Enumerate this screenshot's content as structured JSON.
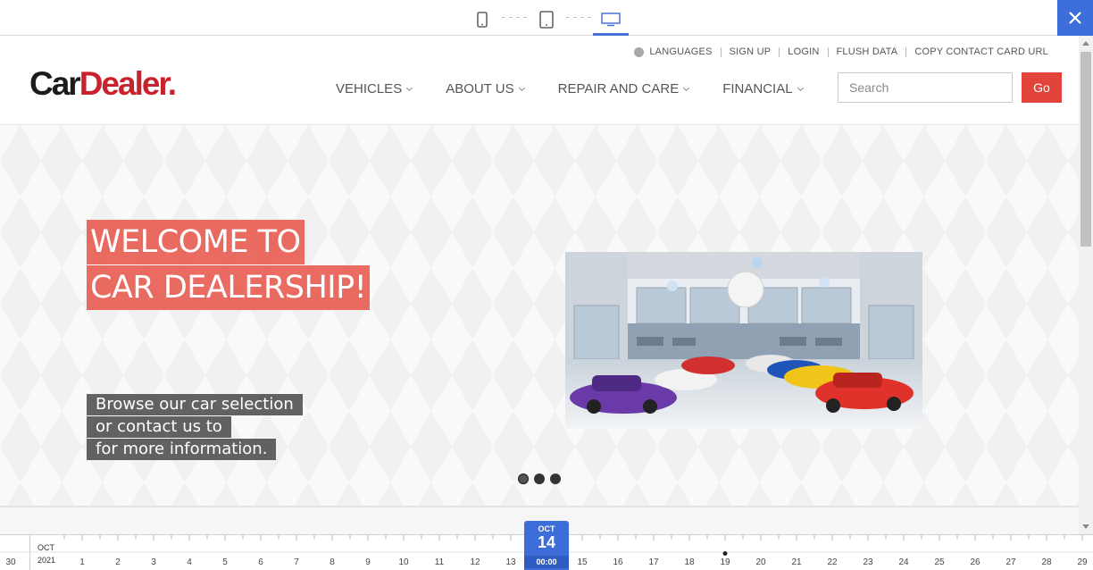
{
  "device_toolbar": {
    "devices": [
      "mobile",
      "tablet",
      "desktop"
    ],
    "active": "desktop",
    "separator": "----",
    "accent_color": "#3c6dd8",
    "close_icon": "close-icon"
  },
  "site": {
    "logo": {
      "part1": "Car",
      "part2": "Dealer."
    },
    "utility_nav": {
      "languages": "LANGUAGES",
      "sign_up": "SIGN UP",
      "login": "LOGIN",
      "flush_data": "FLUSH DATA",
      "copy_contact": "COPY CONTACT CARD URL"
    },
    "main_nav": [
      {
        "label": "VEHICLES"
      },
      {
        "label": "ABOUT US"
      },
      {
        "label": "REPAIR AND CARE"
      },
      {
        "label": "FINANCIAL"
      }
    ],
    "search": {
      "placeholder": "Search",
      "value": "",
      "button": "Go"
    },
    "colors": {
      "brand_red": "#c8232c",
      "go_button": "#e2433a",
      "title_bg": "#e86055"
    }
  },
  "hero": {
    "title_line1": "WELCOME TO",
    "title_line2": "CAR DEALERSHIP!",
    "sub_line1": "Browse our car selection",
    "sub_line2": "or contact us to",
    "sub_line3": "for more information.",
    "slides": 3,
    "active_slide": 1
  },
  "timeline": {
    "prev_day": "30",
    "month": "OCT",
    "year": "2021",
    "days": [
      "1",
      "2",
      "3",
      "4",
      "5",
      "6",
      "7",
      "8",
      "9",
      "10",
      "11",
      "12",
      "13",
      "15",
      "16",
      "17",
      "18",
      "19",
      "20",
      "21",
      "22",
      "23",
      "24",
      "25",
      "26",
      "27",
      "28",
      "29"
    ],
    "current": {
      "month": "OCT",
      "day": "14",
      "time": "00:00"
    },
    "marked_day": "19"
  }
}
